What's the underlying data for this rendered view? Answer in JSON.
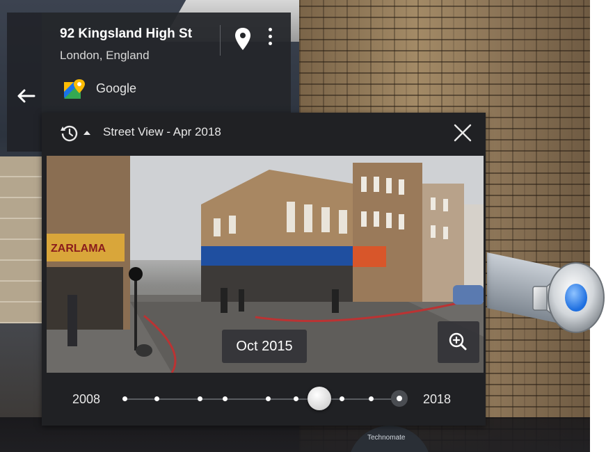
{
  "location": {
    "title": "92 Kingsland High St",
    "subtitle": "London, England",
    "source": "Google"
  },
  "time_machine": {
    "header_title": "Street View - Apr 2018",
    "preview_date": "Oct 2015",
    "timeline": {
      "start_label": "2008",
      "end_label": "2018",
      "selected_position": 0.7
    }
  },
  "background_sign_text": "Technomate",
  "preview_scene": {
    "shop_sign": "ZARLAMA"
  },
  "icons": {
    "back": "arrow-left-icon",
    "pin": "location-pin-icon",
    "more": "more-vert-icon",
    "maps": "google-maps-logo-icon",
    "history": "history-icon",
    "close": "close-icon",
    "zoom": "zoom-in-icon",
    "speaker": "speaker-audio-icon"
  },
  "colors": {
    "panel_bg": "#202124",
    "card_bg": "#24262a",
    "speaker_accent": "#1e6fe0"
  }
}
